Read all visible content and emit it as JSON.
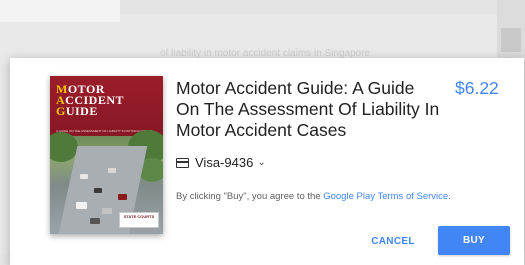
{
  "background": {
    "faded_text": "of liability in motor accident claims in Singapore"
  },
  "book": {
    "cover_title_line1_cap": "M",
    "cover_title_line1_rest": "OTOR",
    "cover_title_line2_cap": "A",
    "cover_title_line2_rest": "CCIDENT",
    "cover_title_line3_cap": "G",
    "cover_title_line3_rest": "UIDE",
    "cover_subtitle": "A GUIDE ON THE ASSESSMENT OF LIABILITY IN MOTOR ACCIDENT CASES",
    "publisher": "STATE COURTS"
  },
  "product": {
    "title": "Motor Accident Guide: A Guide On The Assessment Of Liability In Motor Accident Cases",
    "price": "$6.22"
  },
  "payment": {
    "method": "Visa-9436",
    "icon": "credit-card-icon"
  },
  "terms": {
    "prefix": "By clicking \"Buy\", you agree to the ",
    "link": "Google Play Terms of Service",
    "suffix": "."
  },
  "buttons": {
    "cancel": "CANCEL",
    "buy": "BUY"
  },
  "colors": {
    "accent": "#4285f4",
    "cover_red": "#9b1d2a",
    "cover_gold": "#f3c400"
  }
}
